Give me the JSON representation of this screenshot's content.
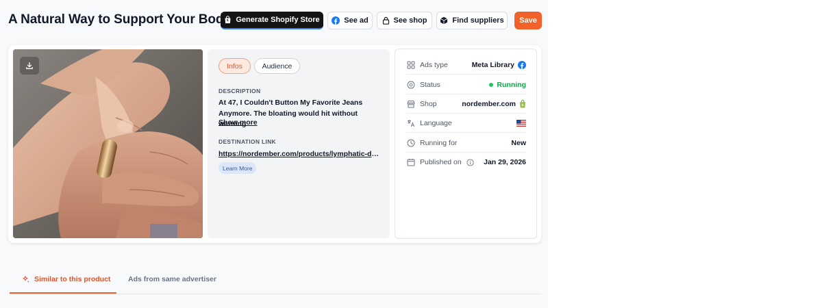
{
  "header": {
    "title": "A Natural Way to Support Your Bod...",
    "buttons": {
      "generate": "Generate Shopify Store",
      "see_ad": "See ad",
      "see_shop": "See shop",
      "find_suppliers": "Find suppliers",
      "save": "Save"
    }
  },
  "media": {
    "image_icon": "hands-ring-photo",
    "download_icon": "download-icon"
  },
  "info": {
    "tabs": [
      "Infos",
      "Audience"
    ],
    "active_tab": "Infos",
    "description_label": "DESCRIPTION",
    "description": "At 47, I Couldn't Button My Favorite Jeans Anymore. The bloating would hit without warning",
    "show_more": "Show more",
    "destination_label": "DESTINATION LINK",
    "destination_link": "https://nordember.com/products/lymphatic-dra...",
    "cta": "Learn More"
  },
  "meta": {
    "rows": [
      {
        "icon": "grid-icon",
        "label": "Ads type",
        "value": "Meta Library",
        "value_icon": "facebook-icon"
      },
      {
        "icon": "status-icon",
        "label": "Status",
        "value": "Running",
        "value_icon": "status-dot"
      },
      {
        "icon": "store-icon",
        "label": "Shop",
        "value": "nordember.com",
        "value_icon": "shopify-icon"
      },
      {
        "icon": "translate-icon",
        "label": "Language",
        "value": "",
        "value_icon": "us-flag-icon"
      },
      {
        "icon": "clock-icon",
        "label": "Running for",
        "value": "New"
      },
      {
        "icon": "calendar-icon",
        "label": "Published on",
        "value": "Jan 29, 2026",
        "label_icon": "info-icon"
      }
    ]
  },
  "bottom_tabs": {
    "items": [
      "Similar to this product",
      "Ads from same advertiser"
    ],
    "active": "Similar to this product"
  },
  "colors": {
    "accent": "#f0622a",
    "running_green": "#16a34a",
    "dark_button": "#141414",
    "facebook_blue": "#1877f2",
    "shopify_green": "#95bf47"
  }
}
